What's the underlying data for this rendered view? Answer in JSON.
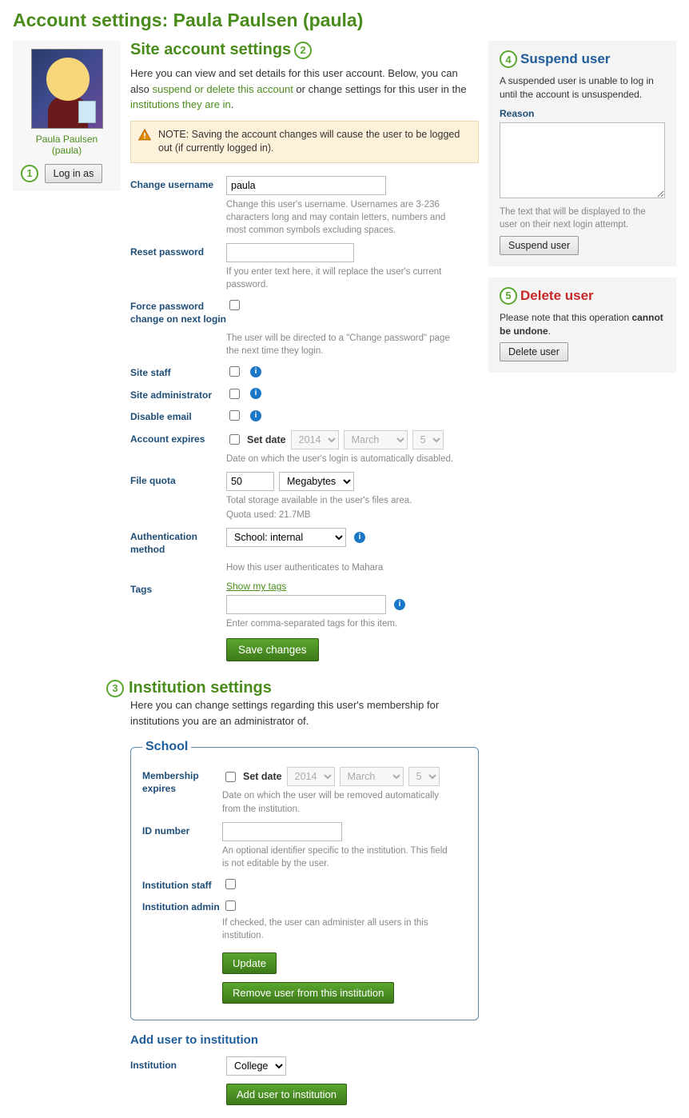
{
  "page_title": "Account settings: Paula Paulsen (paula)",
  "sidebar": {
    "username_display": "Paula Paulsen (paula)",
    "login_as_label": "Log in as"
  },
  "callouts": {
    "c1": "1",
    "c2": "2",
    "c3": "3",
    "c4": "4",
    "c5": "5"
  },
  "site": {
    "heading": "Site account settings",
    "intro_pre": "Here you can view and set details for this user account. Below, you can also ",
    "intro_link1": "suspend or delete this account",
    "intro_mid": " or change settings for this user in the ",
    "intro_link2": "institutions they are in",
    "intro_post": ".",
    "note": "NOTE: Saving the account changes will cause the user to be logged out (if currently logged in).",
    "fields": {
      "change_username": {
        "label": "Change username",
        "value": "paula",
        "help": "Change this user's username. Usernames are 3-236 characters long and may contain letters, numbers and most common symbols excluding spaces."
      },
      "reset_password": {
        "label": "Reset password",
        "help": "If you enter text here, it will replace the user's current password."
      },
      "force_pw": {
        "label": "Force password change on next login",
        "help": "The user will be directed to a \"Change password\" page the next time they login."
      },
      "site_staff": {
        "label": "Site staff"
      },
      "site_admin": {
        "label": "Site administrator"
      },
      "disable_email": {
        "label": "Disable email"
      },
      "expires": {
        "label": "Account expires",
        "set_date": "Set date",
        "year": "2014",
        "month": "March",
        "day": "5",
        "help": "Date on which the user's login is automatically disabled."
      },
      "quota": {
        "label": "File quota",
        "value": "50",
        "unit": "Megabytes",
        "help": "Total storage available in the user's files area.",
        "used": "Quota used: 21.7MB"
      },
      "auth": {
        "label": "Authentication method",
        "value": "School: internal",
        "help": "How this user authenticates to Mahara"
      },
      "tags": {
        "label": "Tags",
        "show": "Show my tags",
        "help": "Enter comma-separated tags for this item."
      }
    },
    "save_label": "Save changes"
  },
  "inst": {
    "heading": "Institution settings",
    "intro": "Here you can change settings regarding this user's membership for institutions you are an administrator of.",
    "school_legend": "School",
    "fields": {
      "expires": {
        "label": "Membership expires",
        "set_date": "Set date",
        "year": "2014",
        "month": "March",
        "day": "5",
        "help": "Date on which the user will be removed automatically from the institution."
      },
      "idnum": {
        "label": "ID number",
        "help": "An optional identifier specific to the institution. This field is not editable by the user."
      },
      "staff": {
        "label": "Institution staff"
      },
      "admin": {
        "label": "Institution admin",
        "help": "If checked, the user can administer all users in this institution."
      }
    },
    "update_label": "Update",
    "remove_label": "Remove user from this institution",
    "add_heading": "Add user to institution",
    "add_label": "Institution",
    "add_value": "College",
    "add_button": "Add user to institution"
  },
  "suspend": {
    "heading": "Suspend user",
    "desc": "A suspended user is unable to log in until the account is unsuspended.",
    "reason_label": "Reason",
    "reason_help": "The text that will be displayed to the user on their next login attempt.",
    "button": "Suspend user"
  },
  "delete": {
    "heading": "Delete user",
    "desc_pre": "Please note that this operation ",
    "desc_strong": "cannot be undone",
    "desc_post": ".",
    "button": "Delete user"
  }
}
